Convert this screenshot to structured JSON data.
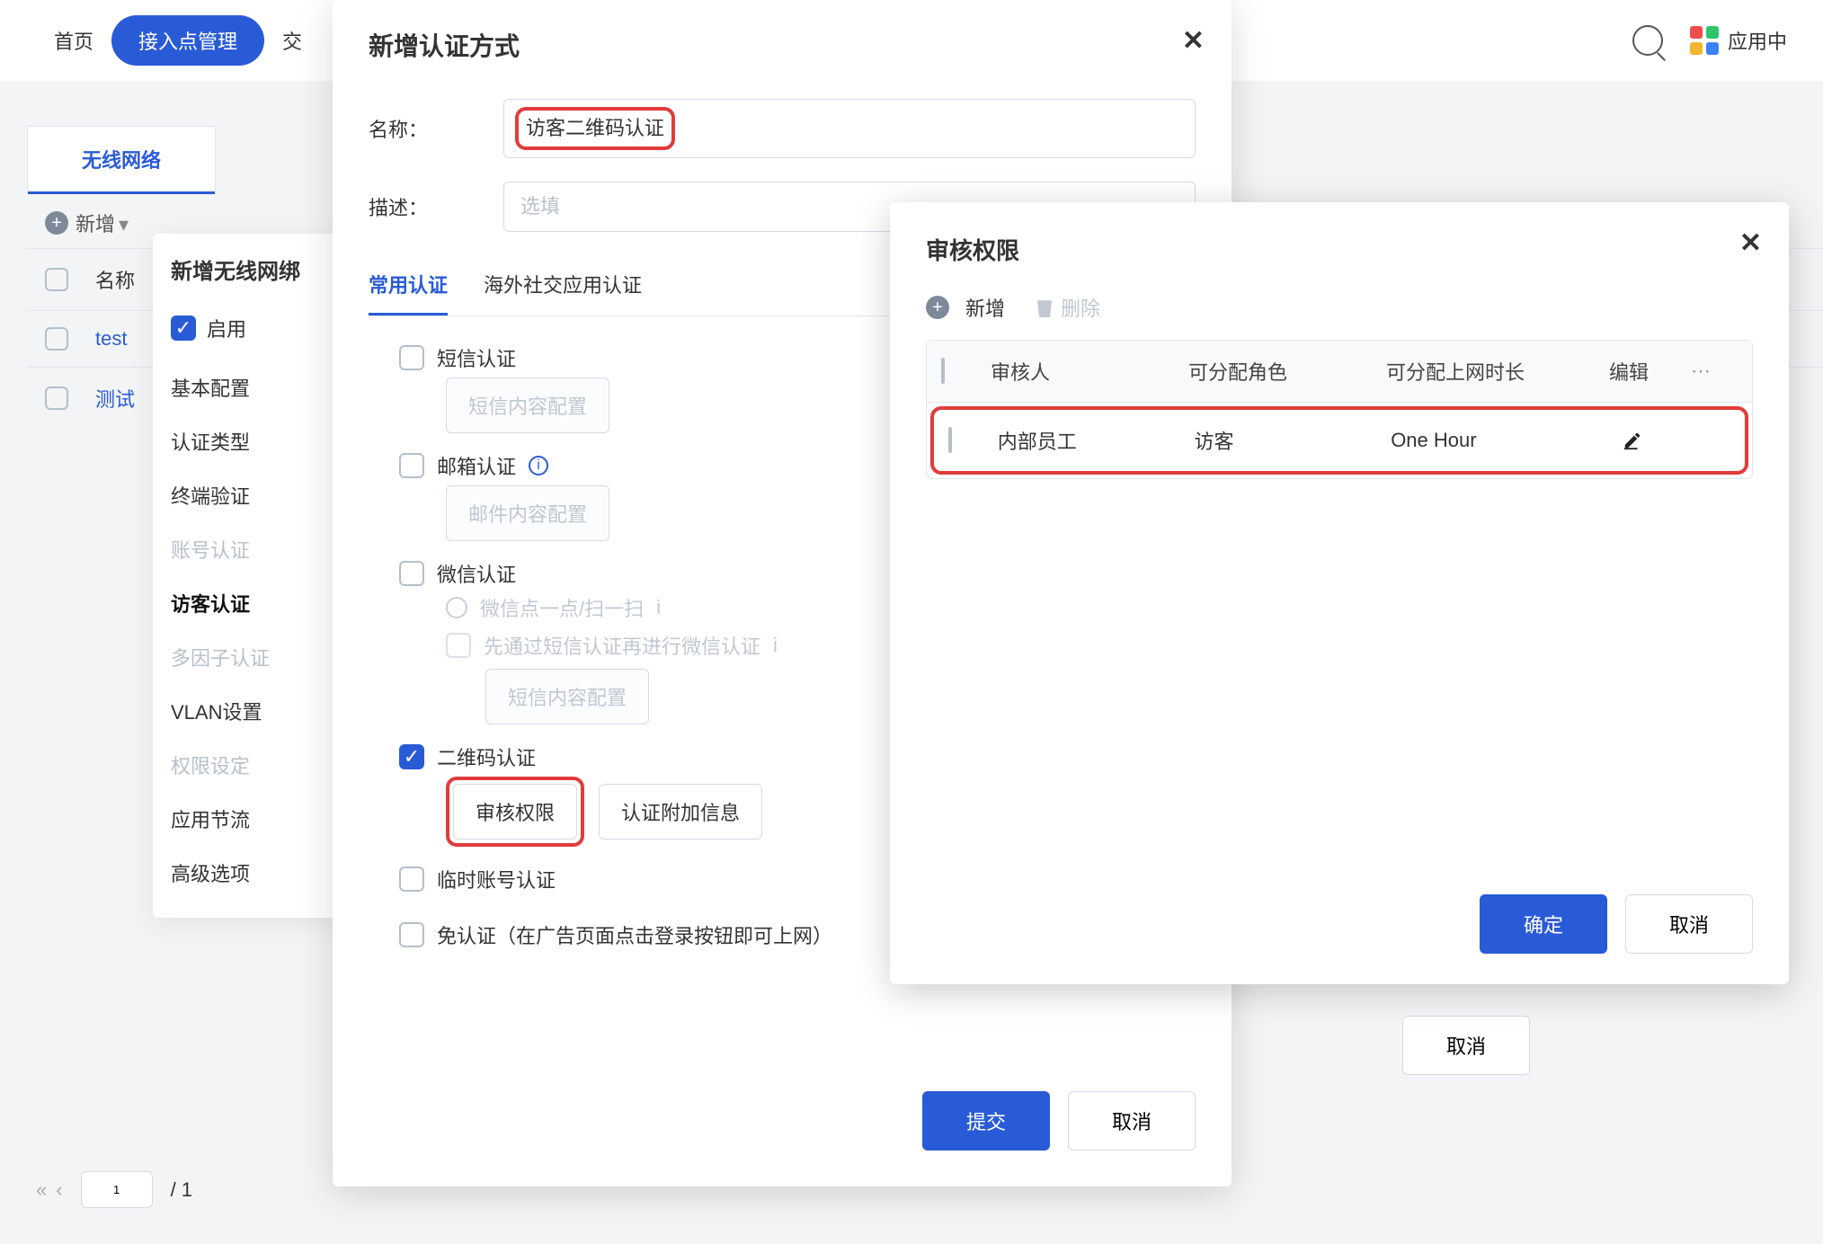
{
  "topbar": {
    "nav": [
      "首页",
      "接入点管理",
      "交"
    ],
    "active_index": 1,
    "search": "",
    "apps_label": "应用中"
  },
  "sub_tabs": {
    "tab_label": "无线网络"
  },
  "table": {
    "add_label": "新增",
    "header_name": "名称",
    "rows": [
      {
        "name": "test"
      },
      {
        "name": "测试"
      }
    ]
  },
  "pager": {
    "page": "1",
    "total": "/ 1"
  },
  "wifi_panel": {
    "title": "新增无线网绑",
    "enable_label": "启用",
    "items": [
      {
        "label": "基本配置",
        "state": "normal"
      },
      {
        "label": "认证类型",
        "state": "normal"
      },
      {
        "label": "终端验证",
        "state": "normal"
      },
      {
        "label": "账号认证",
        "state": "disabled"
      },
      {
        "label": "访客认证",
        "state": "current"
      },
      {
        "label": "多因子认证",
        "state": "disabled"
      },
      {
        "label": "VLAN设置",
        "state": "normal"
      },
      {
        "label": "权限设定",
        "state": "disabled"
      },
      {
        "label": "应用节流",
        "state": "normal"
      },
      {
        "label": "高级选项",
        "state": "normal"
      }
    ]
  },
  "auth_modal": {
    "title": "新增认证方式",
    "name_label": "名称：",
    "name_value": "访客二维码认证",
    "desc_label": "描述：",
    "desc_placeholder": "选填",
    "tabs": {
      "common": "常用认证",
      "overseas": "海外社交应用认证"
    },
    "options": {
      "sms": "短信认证",
      "sms_btn": "短信内容配置",
      "email": "邮箱认证",
      "email_btn": "邮件内容配置",
      "wechat": "微信认证",
      "wechat_sub1": "微信点一点/扫一扫",
      "wechat_sub2": "先通过短信认证再进行微信认证",
      "wechat_sub2_btn": "短信内容配置",
      "qrcode": "二维码认证",
      "qrcode_btn1": "审核权限",
      "qrcode_btn2": "认证附加信息",
      "temp": "临时账号认证",
      "noauth": "免认证（在广告页面点击登录按钮即可上网）"
    },
    "submit": "提交",
    "cancel": "取消"
  },
  "floating_cancel": "取消",
  "perm_modal": {
    "title": "审核权限",
    "add": "新增",
    "del": "删除",
    "headers": {
      "reviewer": "审核人",
      "role": "可分配角色",
      "duration": "可分配上网时长",
      "edit": "编辑"
    },
    "row": {
      "reviewer": "内部员工",
      "role": "访客",
      "duration": "One Hour"
    },
    "ok": "确定",
    "cancel": "取消"
  }
}
